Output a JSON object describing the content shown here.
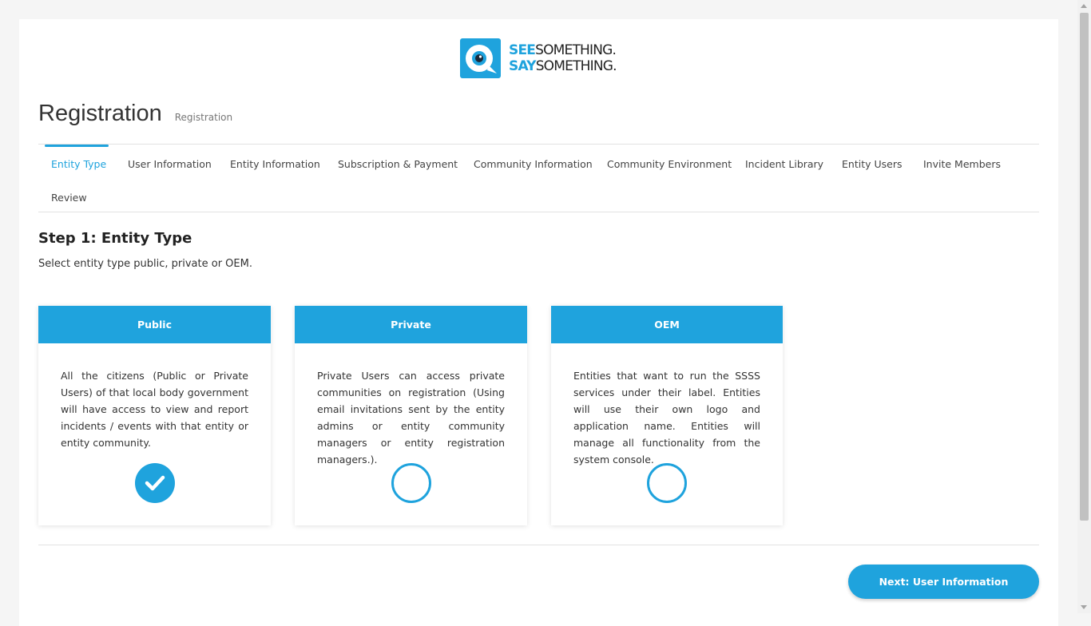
{
  "logo": {
    "line1_bold": "SEE",
    "line1_rest": "SOMETHING.",
    "line2_bold": "SAY",
    "line2_rest": "SOMETHING."
  },
  "header": {
    "title": "Registration",
    "breadcrumb": "Registration"
  },
  "tabs": [
    {
      "label": "Entity Type",
      "active": true
    },
    {
      "label": "User Information"
    },
    {
      "label": "Entity Information"
    },
    {
      "label": "Subscription & Payment"
    },
    {
      "label": "Community Information"
    },
    {
      "label": "Community Environment"
    },
    {
      "label": "Incident Library"
    },
    {
      "label": "Entity Users"
    },
    {
      "label": "Invite Members"
    },
    {
      "label": "Review"
    }
  ],
  "step": {
    "title": "Step 1: Entity Type",
    "description": "Select entity type public, private or OEM."
  },
  "cards": [
    {
      "title": "Public",
      "body": "All the citizens (Public or Private Users) of that local body government will have access to view and report incidents / events with that entity or entity community.",
      "selected": true
    },
    {
      "title": "Private",
      "body": "Private Users can access private communities on registration (Using email invitations sent by the entity admins or entity community managers or entity registration managers.).",
      "selected": false
    },
    {
      "title": "OEM",
      "body": "Entities that want to run the SSSS services under their label. Entities will use their own logo and application name. Entities will manage all functionality from the system console.",
      "selected": false
    }
  ],
  "footer": {
    "next_label": "Next: User Information"
  },
  "colors": {
    "accent": "#1fa3dd"
  }
}
